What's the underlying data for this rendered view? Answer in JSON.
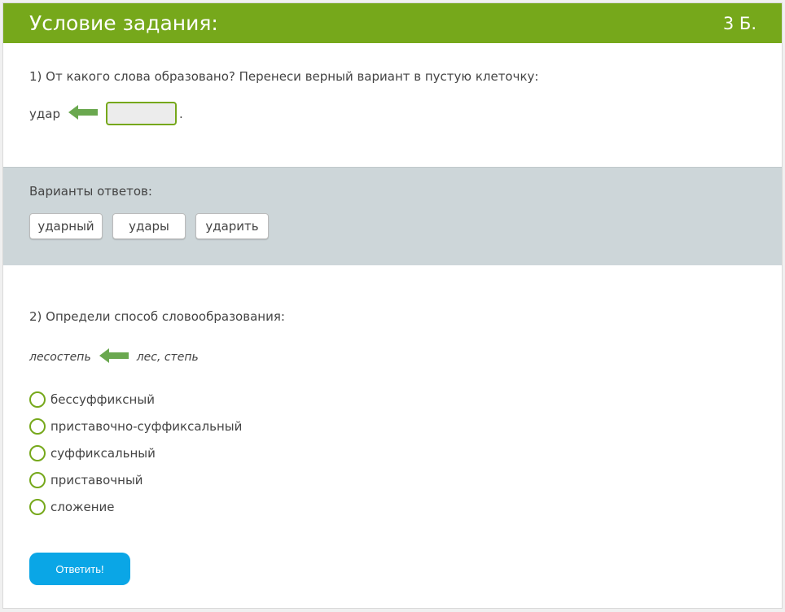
{
  "header": {
    "title": "Условие задания:",
    "points": "3 Б."
  },
  "task1": {
    "question": "1) От какого слова образовано? Перенеси верный вариант в пустую клеточку:",
    "word": "удар",
    "trailing_punct": ".",
    "arrow_icon": "left-arrow-icon"
  },
  "answers": {
    "label": "Варианты ответов:",
    "chips": [
      "ударный",
      "удары",
      "ударить"
    ]
  },
  "task2": {
    "question": "2) Определи способ словообразования:",
    "derived_word": "лесостепь",
    "source_words": "лес, степь",
    "options": [
      "бессуффиксный",
      "приставочно-суффиксальный",
      "суффиксальный",
      "приставочный",
      "сложение"
    ]
  },
  "submit": {
    "label": "Ответить!"
  },
  "colors": {
    "accent": "#76a81b",
    "button": "#0aa6e6",
    "answer_bg": "#cdd6d9"
  }
}
